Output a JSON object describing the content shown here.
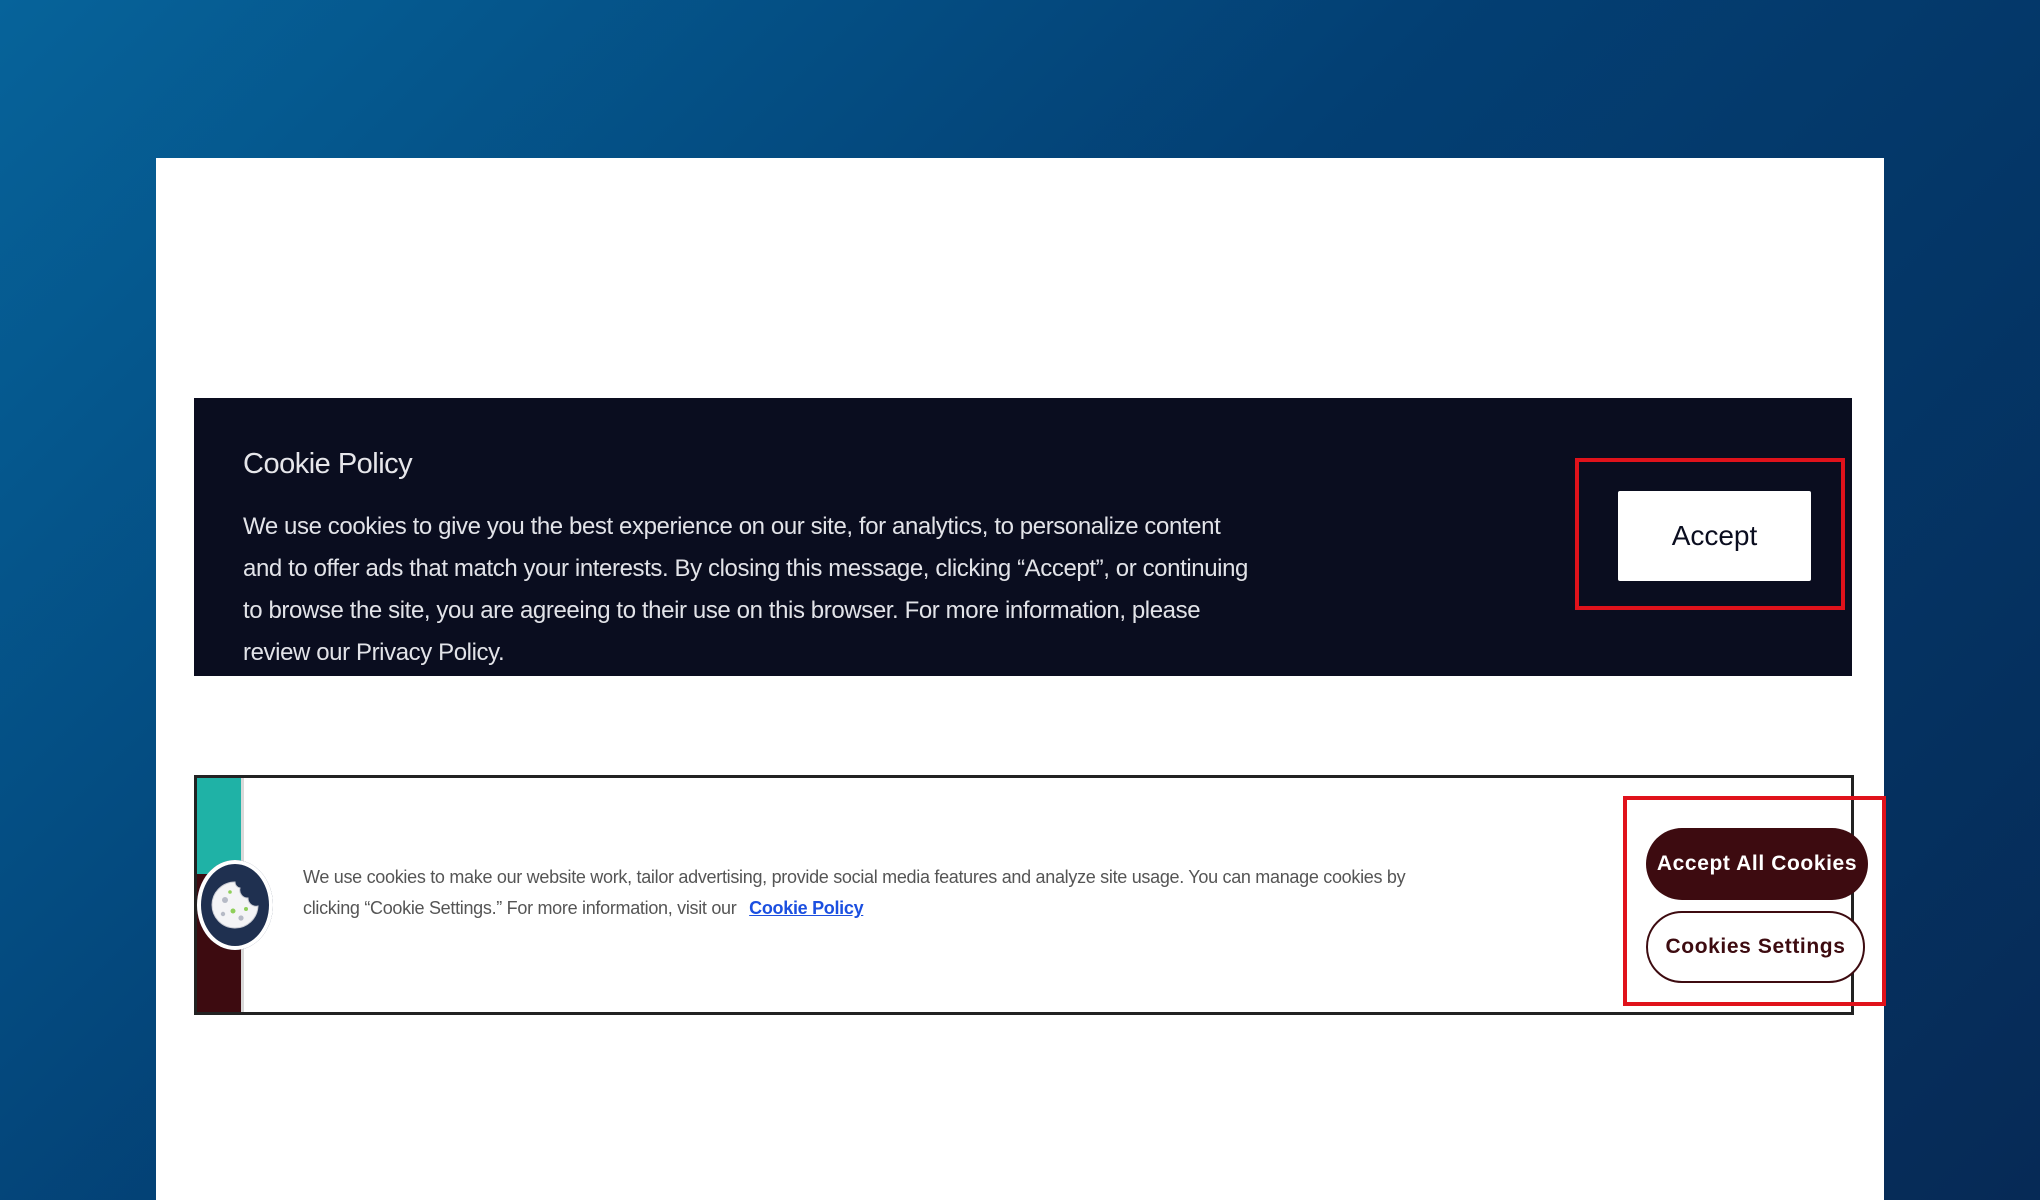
{
  "banner_dark": {
    "title": "Cookie Policy",
    "body": "We use cookies to give you the best experience on our site, for analytics, to personalize content and to offer ads that match your interests. By closing this message, clicking “Accept”, or continuing to browse the site, you are agreeing to their use on this browser. For more information, please review our Privacy Policy.",
    "accept_label": "Accept",
    "background_color": "#0a0d1f"
  },
  "banner_light": {
    "body": "We use cookies to make our website work, tailor advertising, provide social media features and analyze site usage. You can manage cookies by clicking “Cookie Settings.” For more information, visit our",
    "policy_link": "Cookie Policy",
    "accept_all_label": "Accept All Cookies",
    "settings_label": "Cookies Settings",
    "logo_icon": "cookie-icon",
    "accent_colors": {
      "teal": "#1fb2a6",
      "maroon": "#3d0b10",
      "link": "#1b4fe0"
    }
  },
  "highlight_color": "#e0121b"
}
